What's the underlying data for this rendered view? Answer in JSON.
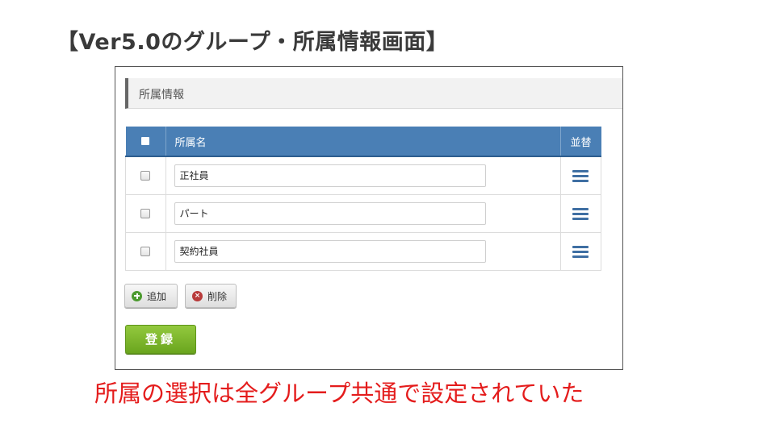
{
  "slide": {
    "title": "【Ver5.0のグループ・所属情報画面】",
    "note": "所属の選択は全グループ共通で設定されていた"
  },
  "panel": {
    "title": "所属情報"
  },
  "table": {
    "headers": {
      "name": "所属名",
      "sort": "並替"
    },
    "rows": [
      {
        "value": "正社員"
      },
      {
        "value": "パート"
      },
      {
        "value": "契約社員"
      }
    ]
  },
  "buttons": {
    "add_label": "追加",
    "delete_label": "削除",
    "register_label": "登録"
  },
  "icons": {
    "add": "plus-circle-icon",
    "delete": "x-circle-icon",
    "sort": "drag-handle-icon"
  },
  "colors": {
    "header_blue": "#4a7fb5",
    "register_green": "#7ab42c",
    "note_red": "#e41c1c"
  }
}
